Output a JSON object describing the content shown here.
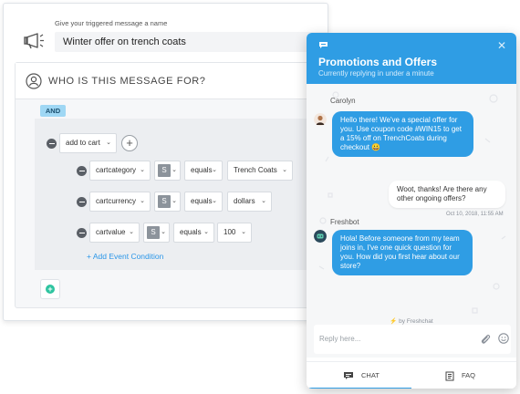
{
  "editor": {
    "name_label": "Give your triggered message a name",
    "name_value": "Winter offer on trench coats",
    "who_title": "WHO IS THIS MESSAGE FOR?",
    "and_badge": "AND",
    "event_select": "add to cart",
    "conditions": [
      {
        "property": "cartcategory",
        "type": "S",
        "operator": "equals",
        "value": "Trench Coats"
      },
      {
        "property": "cartcurrency",
        "type": "S",
        "operator": "equals",
        "value": "dollars"
      },
      {
        "property": "cartvalue",
        "type": "S",
        "operator": "equals",
        "value": "100"
      }
    ],
    "add_event_condition": "+ Add Event Condition"
  },
  "chat": {
    "title": "Promotions and Offers",
    "subtitle": "Currently replying in under a minute",
    "messages": [
      {
        "sender": "Carolyn",
        "text": "Hello there! We've a special offer for you. Use coupon code #WIN15 to get a 15% off on TrenchCoats during checkout 😀"
      },
      {
        "sender": "",
        "text": "Woot, thanks! Are there any other ongoing offers?"
      },
      {
        "sender": "Freshbot",
        "text": "Hola! Before someone from my team joins in, I've one quick question for you. How did you first hear about our store?"
      }
    ],
    "timestamp": "Oct 10, 2018, 11:55 AM",
    "powered_by": "⚡ by Freshchat",
    "reply_placeholder": "Reply here...",
    "tabs": [
      "CHAT",
      "FAQ"
    ]
  },
  "colors": {
    "chat_blue": "#2f9de4",
    "add_green": "#2ec4a0",
    "and_badge": "#9fd7f4",
    "link_blue": "#2c97e8"
  },
  "icons": [
    "megaphone-icon",
    "target-user-icon",
    "remove-condition-icon",
    "add-circle-icon",
    "close-icon",
    "chat-bubble-icon",
    "attach-icon",
    "emoji-icon",
    "faq-icon"
  ]
}
